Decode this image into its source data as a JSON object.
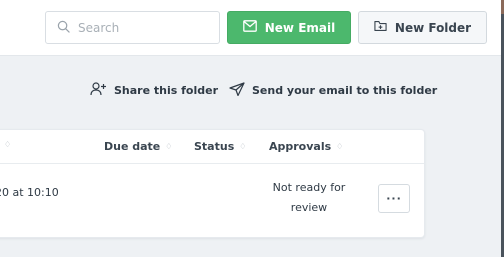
{
  "toolbar": {
    "search_placeholder": "Search",
    "new_email_label": "New Email",
    "new_folder_label": "New Folder"
  },
  "folder_actions": {
    "share_label": "Share this folder",
    "send_label": "Send your email to this folder"
  },
  "table": {
    "columns": {
      "sort_indicator": "♢",
      "due_date": "Due date",
      "status": "Status",
      "approvals": "Approvals"
    },
    "rows": [
      {
        "date_partial": "20 at 10:10",
        "approval_status": "Not ready for review",
        "more_label": "···"
      }
    ]
  },
  "colors": {
    "primary_green": "#4cb86d",
    "page_background": "#eef1f4"
  },
  "icons": {
    "search": "search-icon",
    "email": "envelope-icon",
    "folder": "folder-plus-icon",
    "share": "add-user-icon",
    "send": "paper-plane-icon"
  }
}
